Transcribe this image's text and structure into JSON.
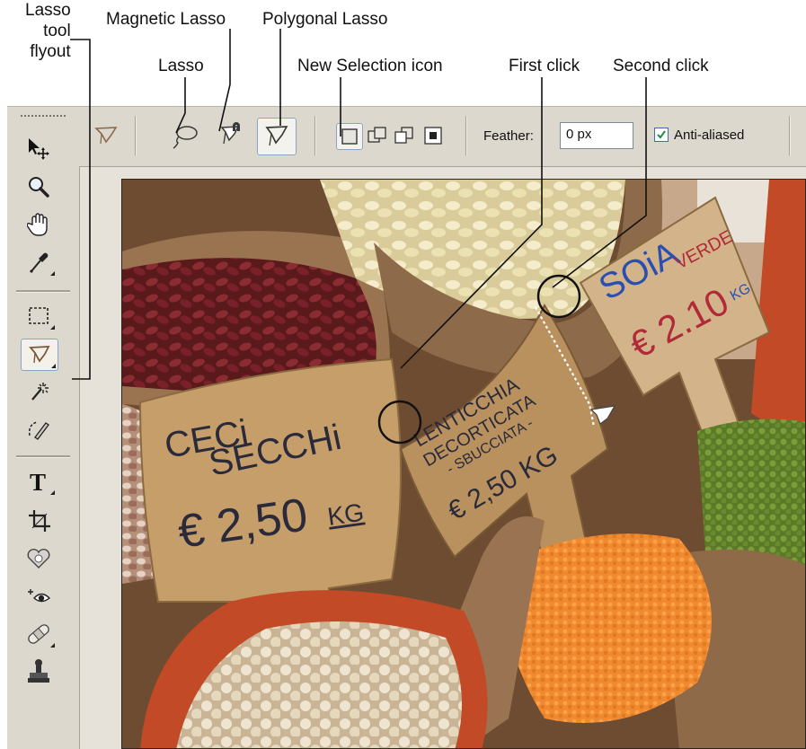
{
  "callouts": {
    "lasso_tool_flyout": [
      "Lasso",
      "tool",
      "flyout"
    ],
    "magnetic_lasso": "Magnetic Lasso",
    "polygonal_lasso": "Polygonal Lasso",
    "lasso": "Lasso",
    "new_selection_icon": "New Selection icon",
    "first_click": "First click",
    "second_click": "Second click"
  },
  "options_bar": {
    "feather_label": "Feather:",
    "feather_value": "0 px",
    "anti_aliased_label": "Anti-aliased",
    "anti_aliased_checked": true
  },
  "toolbox": {
    "tools": [
      "move-icon",
      "zoom-icon",
      "hand-icon",
      "eyedropper-icon",
      "marquee-icon",
      "polygonal-lasso-icon",
      "magic-wand-icon",
      "quick-selection-icon",
      "type-icon",
      "crop-icon",
      "healing-icon",
      "red-eye-icon",
      "bandage-icon",
      "stamp-icon"
    ],
    "active_tool": "polygonal-lasso-icon"
  },
  "photo": {
    "signs": [
      {
        "lines": [
          "CECi",
          "SECCHi",
          "€ 2,50",
          "KG"
        ]
      },
      {
        "lines": [
          "LENTICCHIA",
          "DECORTICATA",
          "- SBUCCIATA -",
          "€ 2,50 KG"
        ]
      },
      {
        "lines": [
          "SOiA",
          "VERDE",
          "€ 2.10",
          "KG"
        ]
      }
    ]
  },
  "colors": {
    "chrome": "#ddd8ce",
    "active_border": "#8aa6c4",
    "checkbox_check": "#2a8a3a"
  }
}
